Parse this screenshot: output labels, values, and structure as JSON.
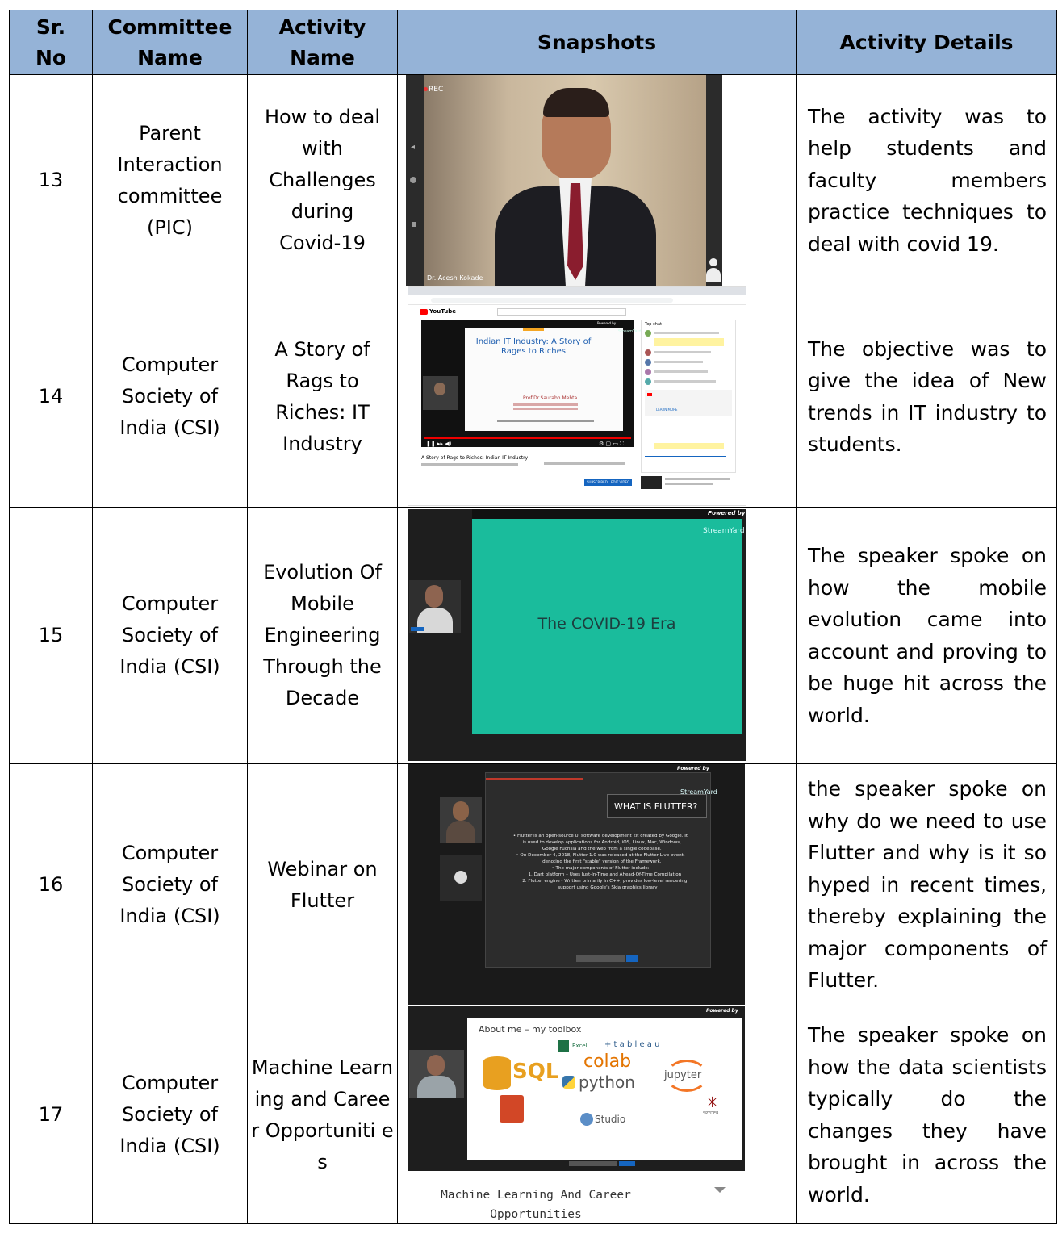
{
  "headers": {
    "sr_no": "Sr. No",
    "committee": "Committee Name",
    "activity": "Activity Name",
    "snapshots": "Snapshots",
    "details": "Activity Details"
  },
  "rows": [
    {
      "sr": "13",
      "committee": "Parent Interaction committee (PIC)",
      "activity": "How to deal with Challenges during Covid-19",
      "details": "The activity was to help students and faculty members practice techniques to deal with covid 19.",
      "snapshot": {
        "rec": "REC",
        "name_tag": "Dr. Acesh Kokade"
      }
    },
    {
      "sr": "14",
      "committee": "Computer Society of India (CSI)",
      "activity": "A Story of Rags to Riches: IT Industry",
      "details": "The objective was to give the idea of New trends in IT industry to students.",
      "snapshot": {
        "slide_title": "Indian IT Industry: A Story of Rages to Riches",
        "presenter": "Prof.Dr.Saurabh Mehta",
        "video_title": "A Story of Rags to Riches: Indian IT Industry",
        "youtube": "YouTube",
        "top_chat": "Top chat",
        "learn_more": "LEARN MORE",
        "subscribed": "SUBSCRIBED",
        "edit_video": "EDIT VIDEO",
        "powered_by": "Powered by",
        "streamyard": "StreamYard"
      }
    },
    {
      "sr": "15",
      "committee": "Computer Society of India (CSI)",
      "activity": "Evolution Of Mobile Engineering Through the Decade",
      "details": "The speaker spoke on how the mobile evolution came into account and proving to be huge hit across the world.",
      "snapshot": {
        "slide_text": "The COVID-19 Era",
        "powered_by": "Powered by",
        "streamyard": "StreamYard"
      }
    },
    {
      "sr": "16",
      "committee": "Computer Society of India (CSI)",
      "activity": "Webinar on Flutter",
      "details": "the speaker spoke on why do we need to use Flutter and why is it so hyped in recent times, thereby explaining the major components of Flutter.",
      "snapshot": {
        "slide_title": "WHAT IS FLUTTER?",
        "bullets": [
          "• Flutter is an open-source UI software development kit created by Google. It",
          "  is used to develop applications for Android, iOS, Linux, Mac, Windows,",
          "  Google Fuchsia and the web from a single codebase.",
          "• On December 4, 2018, Flutter 1.0 was released at the Flutter Live event,",
          "  denoting the first \"stable\" version of the Framework.",
          "• The major components of Flutter include:",
          "      1. Dart platform – Uses Just-In-Time and Ahead-Of-Time Compilation",
          "      2. Flutter engine - Written primarily in C++, provides low-level rendering",
          "          support using Google's Skia graphics library"
        ],
        "powered_by": "Powered by",
        "streamyard": "StreamYard"
      }
    },
    {
      "sr": "17",
      "committee": "Computer Society of India (CSI)",
      "activity": "Machine Learning and Career Opportuniti es",
      "details": "The speaker spoke on how the data scientists typically do the changes they have brought in across the world.",
      "snapshot": {
        "slide_title": "About me – my toolbox",
        "tools": {
          "excel": "Excel",
          "tableau": "+ t a b l e a u",
          "sql": "SQL",
          "colab": "colab",
          "python": "python",
          "jupyter": "jupyter",
          "rstudio": "Studio",
          "spyder": "SPYDER"
        },
        "caption": "Machine Learning And Career Opportunities",
        "powered_by": "Powered by"
      }
    }
  ]
}
